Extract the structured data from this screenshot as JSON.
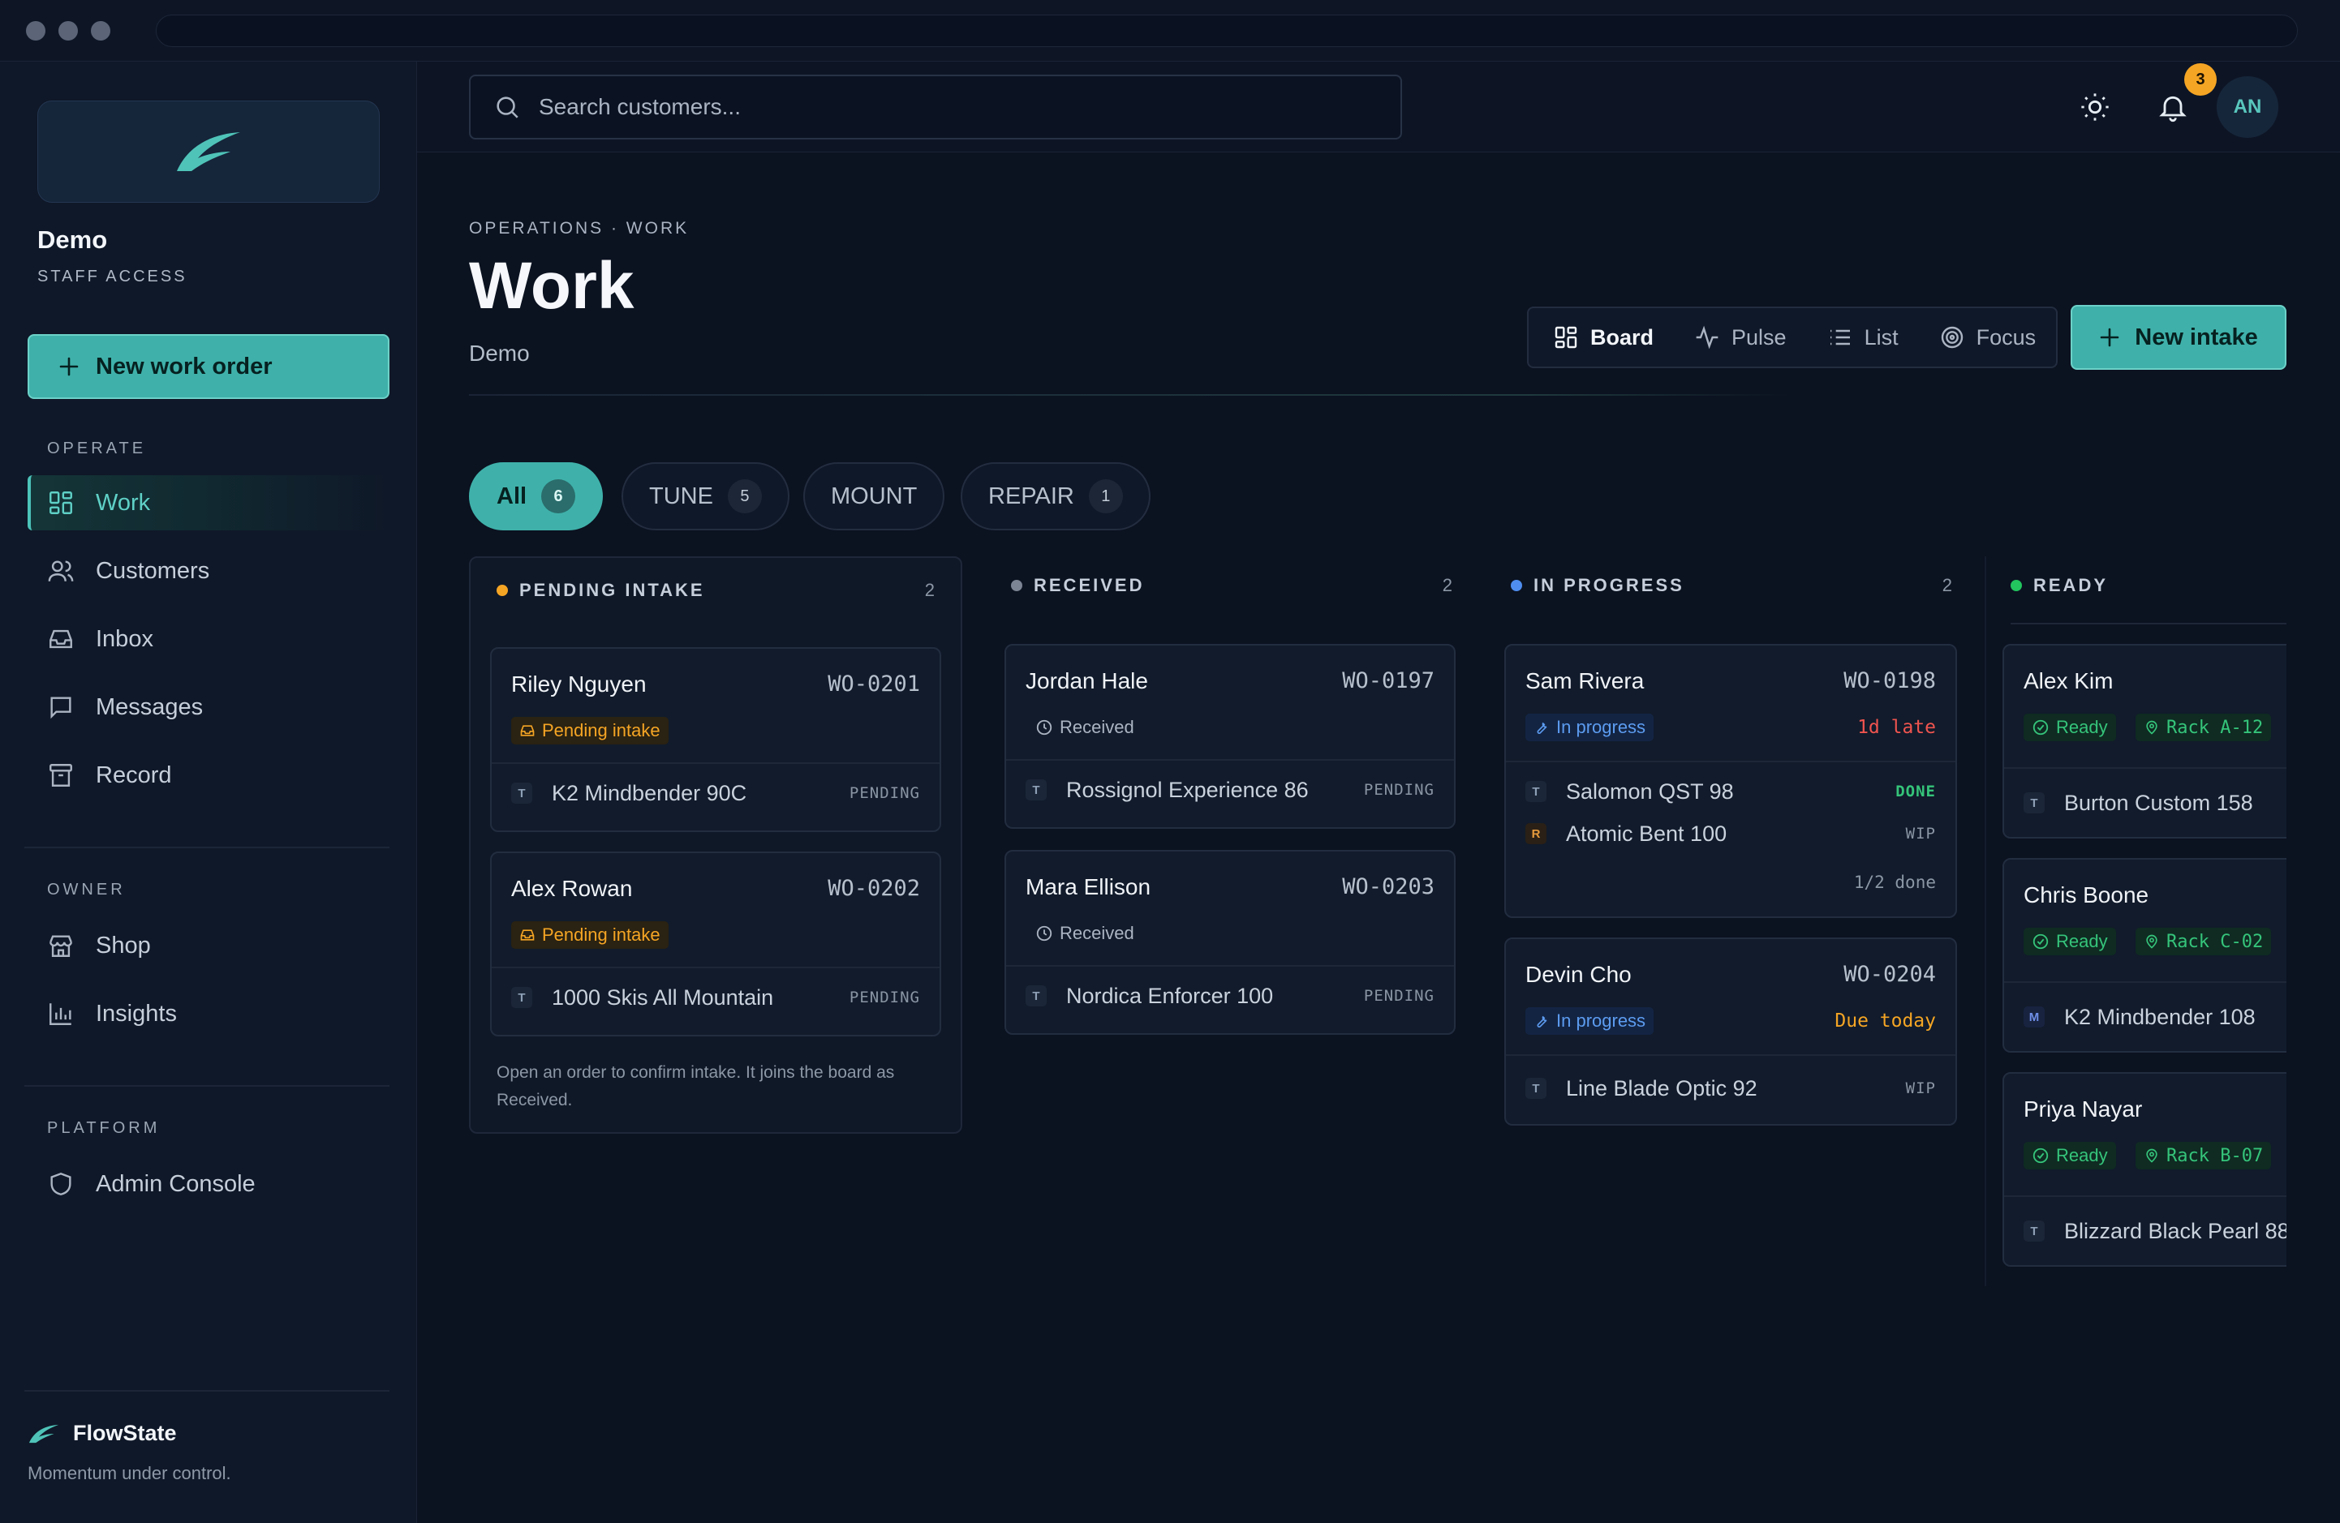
{
  "sidebar": {
    "org_name": "Demo",
    "org_sub": "STAFF ACCESS",
    "new_work_order": "New work order",
    "sections": {
      "operate": "OPERATE",
      "owner": "OWNER",
      "platform": "PLATFORM"
    },
    "operate_items": [
      "Work",
      "Customers",
      "Inbox",
      "Messages",
      "Record"
    ],
    "owner_items": [
      "Shop",
      "Insights"
    ],
    "platform_items": [
      "Admin Console"
    ],
    "brand": "FlowState",
    "tagline": "Momentum under control."
  },
  "topbar": {
    "search_placeholder": "Search customers...",
    "notifications": "3",
    "avatar": "AN"
  },
  "page": {
    "breadcrumb": "OPERATIONS · WORK",
    "title": "Work",
    "subtitle": "Demo",
    "views": [
      "Board",
      "Pulse",
      "List",
      "Focus"
    ],
    "active_view": "Board",
    "new_intake": "New intake"
  },
  "filters": [
    {
      "label": "All",
      "count": "6"
    },
    {
      "label": "TUNE",
      "count": "5"
    },
    {
      "label": "MOUNT",
      "count": ""
    },
    {
      "label": "REPAIR",
      "count": "1"
    }
  ],
  "colors": {
    "accent": "#3fb1aa",
    "pending": "#f5a524",
    "received": "#7c8594",
    "in_progress": "#4f8ef0",
    "ready": "#22c55e",
    "late": "#f0544f"
  },
  "board": {
    "pending": {
      "title": "PENDING INTAKE",
      "count": "2",
      "note": "Open an order to confirm intake. It joins the board as Received.",
      "cards": [
        {
          "name": "Riley Nguyen",
          "wo": "WO-0201",
          "status": "Pending intake",
          "items": [
            {
              "tag": "T",
              "name": "K2 Mindbender 90C",
              "state": "PENDING"
            }
          ]
        },
        {
          "name": "Alex Rowan",
          "wo": "WO-0202",
          "status": "Pending intake",
          "items": [
            {
              "tag": "T",
              "name": "1000 Skis All Mountain",
              "state": "PENDING"
            }
          ]
        }
      ]
    },
    "received": {
      "title": "RECEIVED",
      "count": "2",
      "cards": [
        {
          "name": "Jordan Hale",
          "wo": "WO-0197",
          "status": "Received",
          "items": [
            {
              "tag": "T",
              "name": "Rossignol Experience 86",
              "state": "PENDING"
            }
          ]
        },
        {
          "name": "Mara Ellison",
          "wo": "WO-0203",
          "status": "Received",
          "items": [
            {
              "tag": "T",
              "name": "Nordica Enforcer 100",
              "state": "PENDING"
            }
          ]
        }
      ]
    },
    "in_progress": {
      "title": "IN PROGRESS",
      "count": "2",
      "cards": [
        {
          "name": "Sam Rivera",
          "wo": "WO-0198",
          "status": "In progress",
          "note": "1d late",
          "items": [
            {
              "tag": "T",
              "name": "Salomon QST 98",
              "state": "DONE"
            },
            {
              "tag": "R",
              "name": "Atomic Bent 100",
              "state": "WIP"
            }
          ],
          "progress": "1/2 done"
        },
        {
          "name": "Devin Cho",
          "wo": "WO-0204",
          "status": "In progress",
          "note": "Due today",
          "items": [
            {
              "tag": "T",
              "name": "Line Blade Optic 92",
              "state": "WIP"
            }
          ]
        }
      ]
    },
    "ready": {
      "title": "READY",
      "cards": [
        {
          "name": "Alex Kim",
          "status": "Ready",
          "rack": "Rack A-12",
          "items": [
            {
              "tag": "T",
              "name": "Burton Custom 158"
            }
          ]
        },
        {
          "name": "Chris Boone",
          "status": "Ready",
          "rack": "Rack C-02",
          "items": [
            {
              "tag": "M",
              "name": "K2 Mindbender 108"
            }
          ]
        },
        {
          "name": "Priya Nayar",
          "status": "Ready",
          "rack": "Rack B-07",
          "items": [
            {
              "tag": "T",
              "name": "Blizzard Black Pearl 88"
            }
          ]
        }
      ]
    }
  }
}
